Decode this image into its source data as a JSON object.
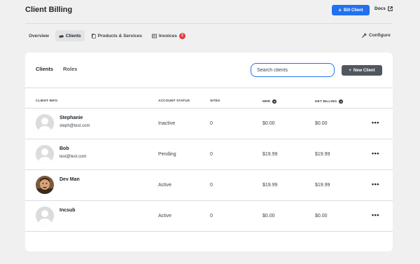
{
  "header": {
    "title": "Client Billing",
    "bill_client_label": "Bill Client",
    "docs_label": "Docs"
  },
  "tabs": [
    {
      "label": "Overview"
    },
    {
      "label": "Clients"
    },
    {
      "label": "Products & Services"
    },
    {
      "label": "Invoices",
      "badge": "2"
    }
  ],
  "configure_label": "Configure",
  "card": {
    "tabs": [
      {
        "label": "Clients"
      },
      {
        "label": "Roles"
      }
    ],
    "search_placeholder": "Search clients",
    "new_client_label": "New Client"
  },
  "table": {
    "columns": [
      "Client Info",
      "Account Status",
      "Sites",
      "MRR",
      "Net Billing"
    ],
    "rows": [
      {
        "name": "Stephanie",
        "email": "steph@test.com",
        "status": "Inactive",
        "sites": "0",
        "mrr": "$0.00",
        "net": "$0.00",
        "actions": "•••"
      },
      {
        "name": "Bob",
        "email": "test@test.com",
        "status": "Pending",
        "sites": "0",
        "mrr": "$19.99",
        "net": "$19.99",
        "actions": "•••"
      },
      {
        "name": "Dev Man",
        "email": "",
        "status": "Active",
        "sites": "0",
        "mrr": "$19.99",
        "net": "$19.99",
        "actions": "•••"
      },
      {
        "name": "Incsub",
        "email": "",
        "status": "Active",
        "sites": "0",
        "mrr": "$0.00",
        "net": "$0.00",
        "actions": "•••"
      }
    ]
  },
  "colors": {
    "accent": "#2271f1",
    "badge": "#e43b3f",
    "dark_button": "#50575e"
  }
}
